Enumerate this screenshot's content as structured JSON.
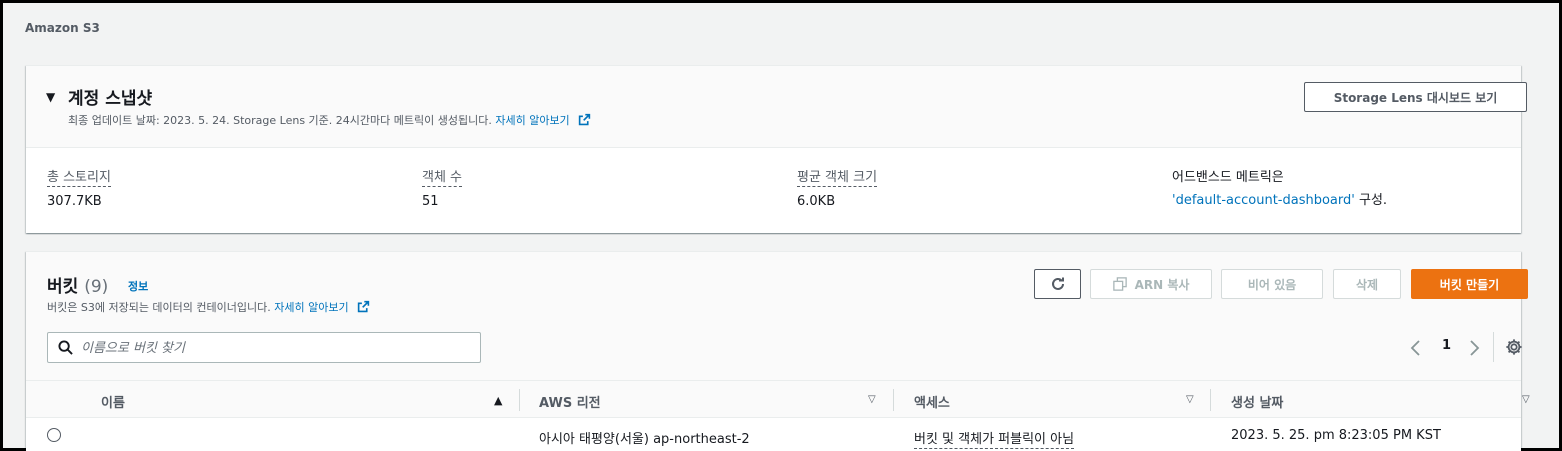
{
  "breadcrumb": "Amazon S3",
  "snapshot": {
    "title": "계정 스냅샷",
    "desc_text": "최종 업데이트 날짜: 2023. 5. 24. Storage Lens 기준. 24시간마다 메트릭이 생성됩니다.",
    "learn_more": "자세히 알아보기",
    "dashboard_button": "Storage Lens 대시보드 보기",
    "metrics": [
      {
        "label": "총 스토리지",
        "value": "307.7KB"
      },
      {
        "label": "객체 수",
        "value": "51"
      },
      {
        "label": "평균 객체 크기",
        "value": "6.0KB"
      }
    ],
    "advanced": {
      "label": "어드밴스드 메트릭은",
      "dashboard_link": "'default-account-dashboard'",
      "suffix": "구성."
    }
  },
  "buckets": {
    "title": "버킷",
    "count": "(9)",
    "info": "정보",
    "desc_text": "버킷은 S3에 저장되는 데이터의 컨테이너입니다.",
    "learn_more": "자세히 알아보기",
    "actions": {
      "copy_arn": "ARN 복사",
      "empty": "비어 있음",
      "delete": "삭제",
      "create": "버킷 만들기"
    },
    "search_placeholder": "이름으로 버킷 찾기",
    "page": "1",
    "columns": [
      "이름",
      "AWS 리전",
      "액세스",
      "생성 날짜"
    ],
    "rows": [
      {
        "name": "",
        "region": "아시아 태평양(서울) ap-northeast-2",
        "access": "버킷 및 객체가 퍼블릭이 아님",
        "created": "2023. 5. 25. pm 8:23:05 PM KST"
      }
    ]
  },
  "colors": {
    "link": "#0073bb",
    "primary": "#ec7211",
    "background": "#f2f3f3"
  },
  "icons": [
    "caret-down-icon",
    "external-link-icon",
    "refresh-icon",
    "copy-icon",
    "search-icon",
    "chevron-left-icon",
    "chevron-right-icon",
    "settings-icon",
    "sort-up-icon",
    "sort-down-icon"
  ]
}
